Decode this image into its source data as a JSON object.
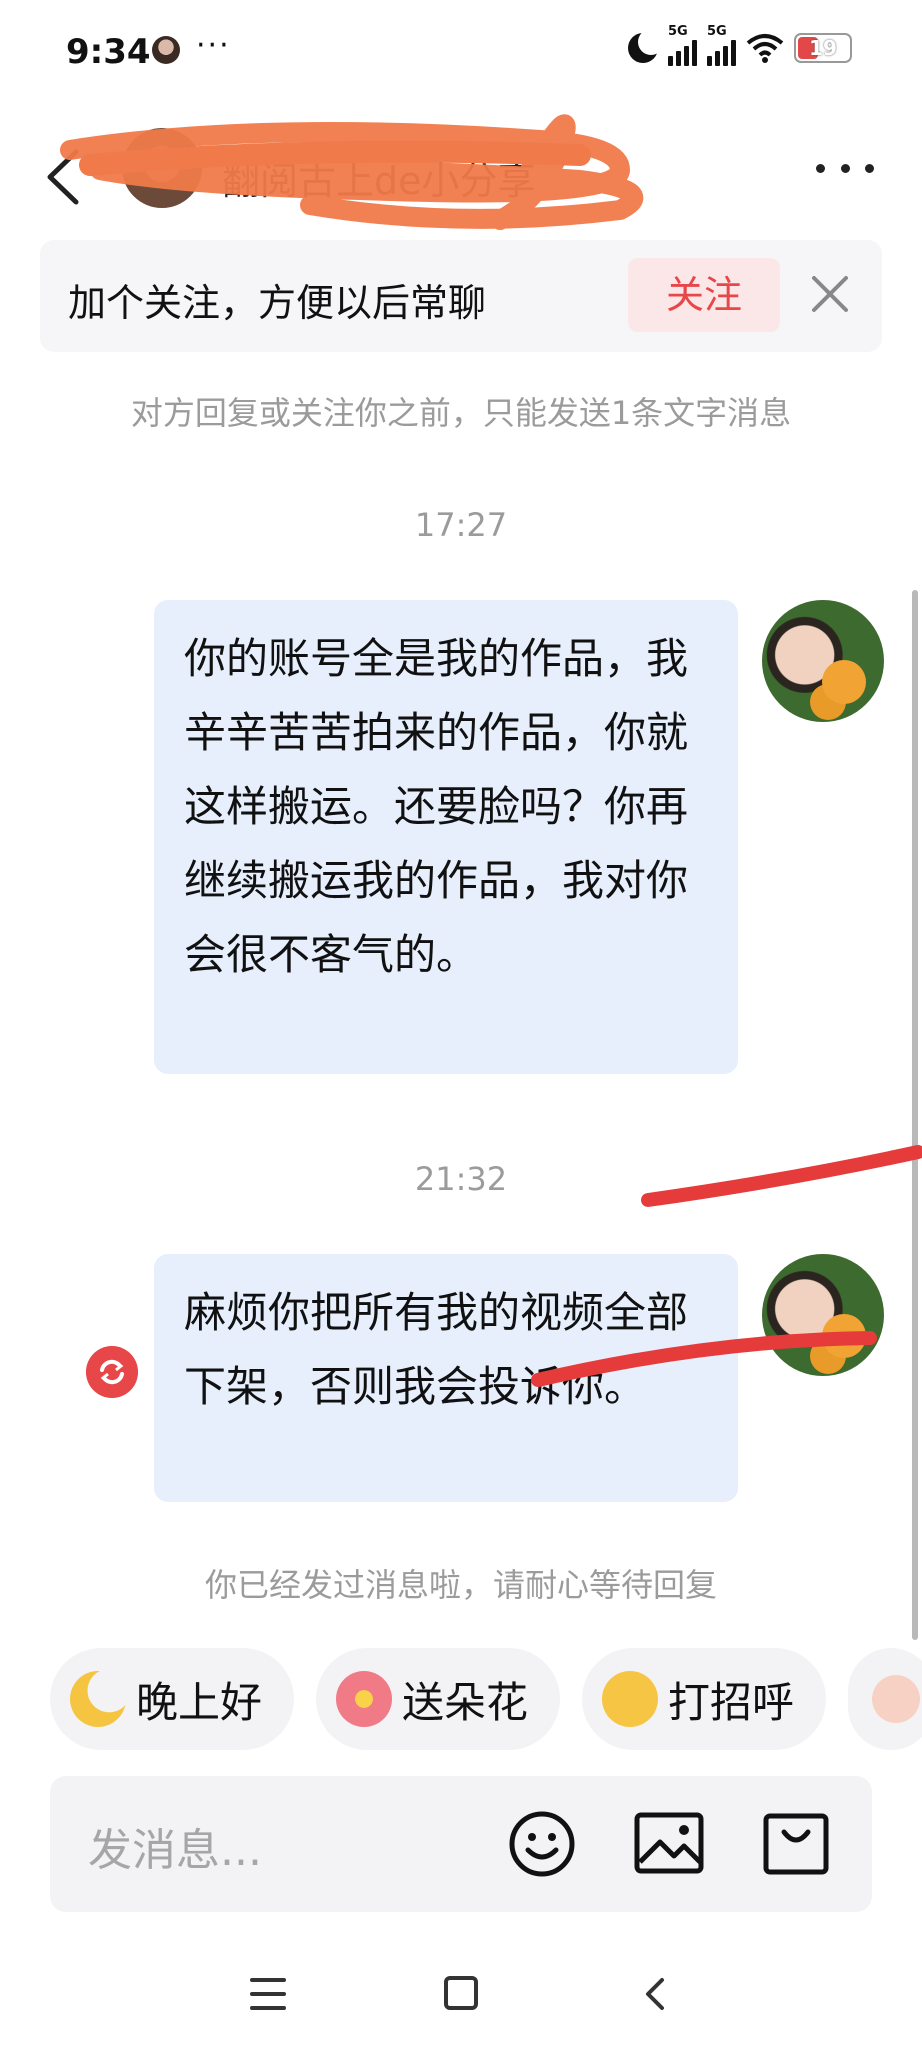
{
  "status_bar": {
    "time": "9:34",
    "dots": "···",
    "net_label_1": "5G",
    "net_label_2": "5G",
    "battery": "19"
  },
  "header": {
    "contact_name": "翻阅古上de小分享"
  },
  "follow_bar": {
    "prompt": "加个关注，方便以后常聊",
    "follow_label": "关注"
  },
  "notice": "对方回复或关注你之前，只能发送1条文字消息",
  "messages": [
    {
      "time": "17:27",
      "text": "你的账号全是我的作品，我辛辛苦苦拍来的作品，你就这样搬运。还要脸吗？你再继续搬运我的作品，我对你会很不客气的。"
    },
    {
      "time": "21:32",
      "text": "麻烦你把所有我的视频全部下架，否则我会投诉你。"
    }
  ],
  "sent_notice": "你已经发过消息啦，请耐心等待回复",
  "quick_replies": [
    "晚上好",
    "送朵花",
    "打招呼"
  ],
  "input": {
    "placeholder": "发消息..."
  },
  "colors": {
    "accent_red": "#e8474a",
    "bubble_blue": "#e7effd",
    "scribble_orange": "#f07a4a"
  }
}
